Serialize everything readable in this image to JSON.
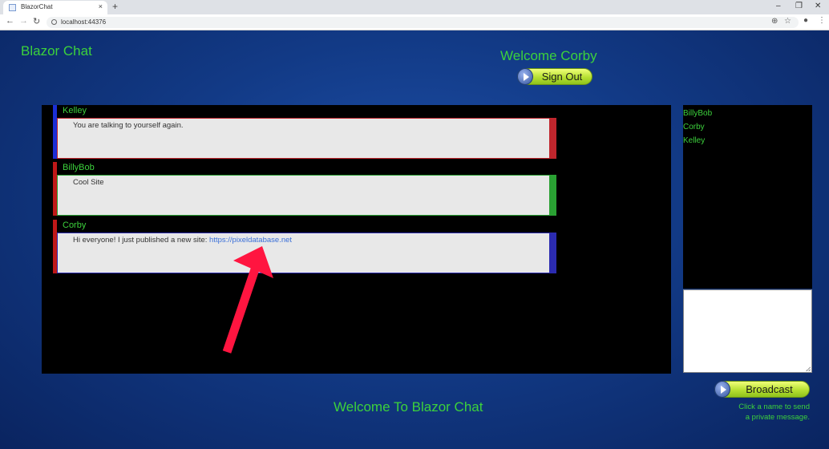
{
  "browser": {
    "tab_title": "BlazorChat",
    "tab_close": "×",
    "new_tab": "+",
    "url": "localhost:44376",
    "back": "←",
    "forward": "→",
    "reload": "↻",
    "zoom_icon": "⊕",
    "star_icon": "☆",
    "account_icon": "●",
    "menu_icon": "⋮",
    "minimize": "–",
    "restore": "❐",
    "close": "✕"
  },
  "app": {
    "title": "Blazor Chat",
    "welcome": "Welcome Corby",
    "sign_out": "Sign Out",
    "broadcast": "Broadcast",
    "footer": "Welcome To Blazor Chat",
    "hint_line1": "Click a name to send",
    "hint_line2": "a private message."
  },
  "messages": [
    {
      "user": "Kelley",
      "text": "You are talking to yourself again.",
      "link": "",
      "bar_color": "#1b2fd6",
      "box_color": "#c0262d"
    },
    {
      "user": "BillyBob",
      "text": "Cool Site",
      "link": "",
      "bar_color": "#c01818",
      "box_color": "#2aa133"
    },
    {
      "user": "Corby",
      "text": "Hi everyone! I just published a new site: ",
      "link": "https://pixeldatabase.net",
      "bar_color": "#c01818",
      "box_color": "#2b2bb0"
    }
  ],
  "users": [
    "BillyBob",
    "Corby",
    "Kelley"
  ],
  "colors": {
    "accent_green": "#3cd13c",
    "annotation_arrow": "#ff1540"
  }
}
